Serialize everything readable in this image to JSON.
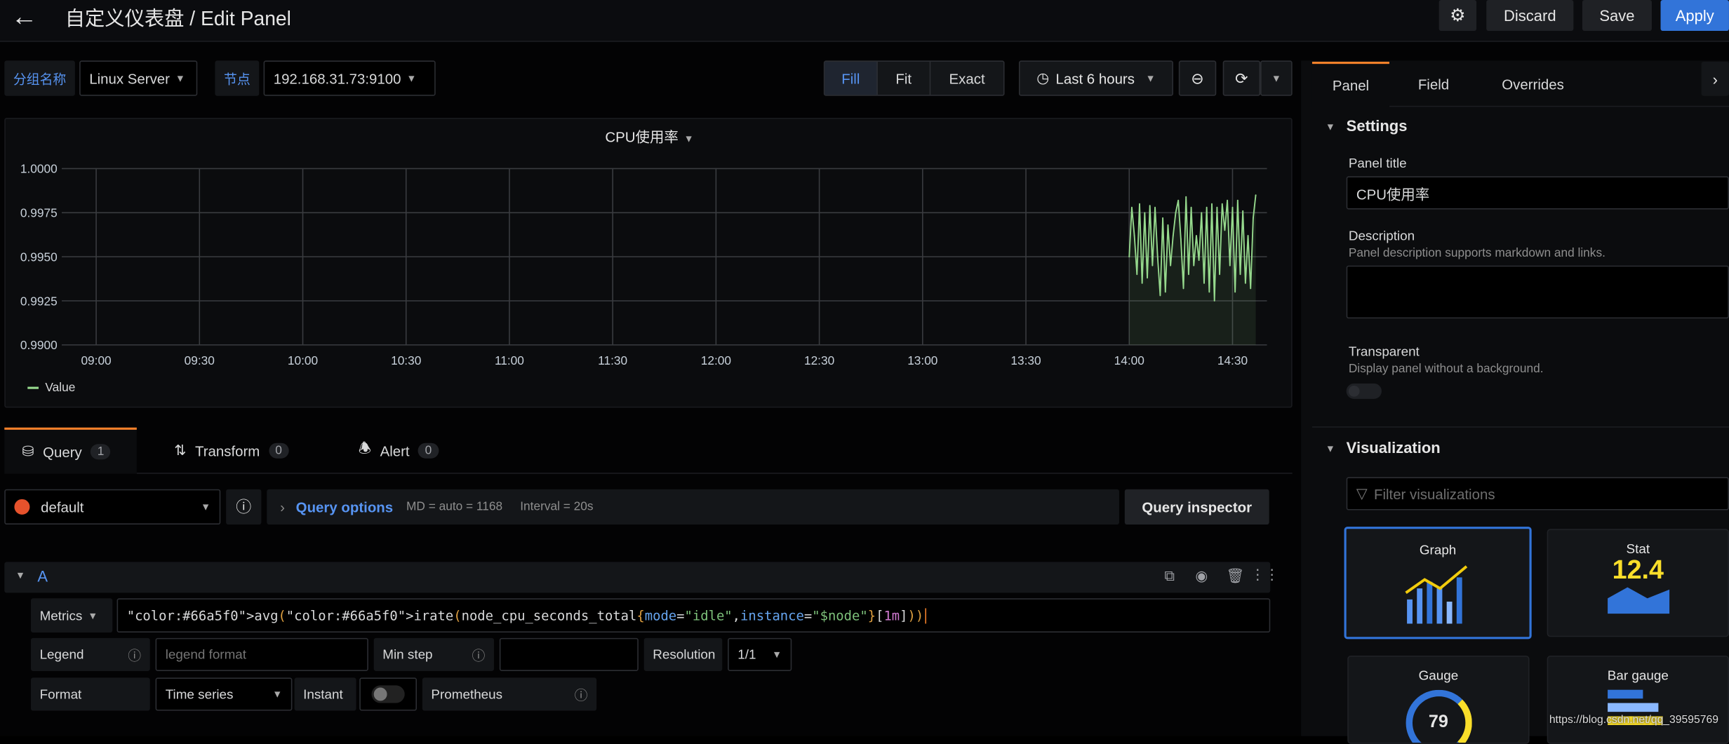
{
  "header": {
    "title": "自定义仪表盘 / Edit Panel",
    "discard": "Discard",
    "save": "Save",
    "apply": "Apply",
    "accent": "#3274d9"
  },
  "variables": [
    {
      "label": "分组名称",
      "value": "Linux Server"
    },
    {
      "label": "节点",
      "value": "192.168.31.73:9100"
    }
  ],
  "view_modes": {
    "options": [
      "Fill",
      "Fit",
      "Exact"
    ],
    "selected": "Fill"
  },
  "time_picker": {
    "value": "Last 6 hours"
  },
  "chart_data": {
    "type": "line",
    "title": "CPU使用率",
    "ylim": [
      0.99,
      1.0
    ],
    "yticks": [
      "1.0000",
      "0.9975",
      "0.9950",
      "0.9925",
      "0.9900"
    ],
    "xticks": [
      "09:00",
      "09:30",
      "10:00",
      "10:30",
      "11:00",
      "11:30",
      "12:00",
      "12:30",
      "13:00",
      "13:30",
      "14:00",
      "14:30"
    ],
    "xlim": [
      "08:50",
      "14:40"
    ],
    "grid": true,
    "legend_position": "bottom-left",
    "series": [
      {
        "name": "Value",
        "color": "#96d98d",
        "x": [
          "14:00",
          "14:00:45",
          "14:01:30",
          "14:02:15",
          "14:03",
          "14:03:45",
          "14:04:30",
          "14:05:15",
          "14:06",
          "14:06:45",
          "14:07:30",
          "14:08:15",
          "14:09",
          "14:09:45",
          "14:10:30",
          "14:11:15",
          "14:12",
          "14:12:45",
          "14:13:30",
          "14:14:15",
          "14:15",
          "14:15:45",
          "14:16:30",
          "14:17:15",
          "14:18",
          "14:18:45",
          "14:19:30",
          "14:20:15",
          "14:21",
          "14:21:45",
          "14:22:30",
          "14:23:15",
          "14:24",
          "14:24:45",
          "14:25:30",
          "14:26:15",
          "14:27",
          "14:27:45",
          "14:28:30",
          "14:29:15",
          "14:30",
          "14:30:45",
          "14:31:30",
          "14:32:15",
          "14:33",
          "14:33:45",
          "14:34:30",
          "14:35:15",
          "14:36",
          "14:36:45"
        ],
        "values": [
          0.995,
          0.9978,
          0.9962,
          0.994,
          0.998,
          0.9935,
          0.9975,
          0.9938,
          0.9979,
          0.9945,
          0.9978,
          0.995,
          0.9928,
          0.9972,
          0.993,
          0.9968,
          0.9945,
          0.9962,
          0.9975,
          0.9982,
          0.996,
          0.9932,
          0.9984,
          0.994,
          0.9978,
          0.9945,
          0.9962,
          0.9948,
          0.9975,
          0.9935,
          0.9978,
          0.993,
          0.998,
          0.9925,
          0.9978,
          0.994,
          0.998,
          0.9965,
          0.9982,
          0.9945,
          0.9978,
          0.993,
          0.9982,
          0.994,
          0.9976,
          0.9935,
          0.9962,
          0.9932,
          0.9972,
          0.9985
        ]
      }
    ]
  },
  "query_tabs": [
    {
      "label": "Query",
      "count": "1"
    },
    {
      "label": "Transform",
      "count": "0"
    },
    {
      "label": "Alert",
      "count": "0"
    }
  ],
  "datasource": {
    "value": "default",
    "query_options": "Query options",
    "md": "MD = auto = 1168",
    "interval": "Interval = 20s",
    "inspector": "Query inspector"
  },
  "query": {
    "ref": "A",
    "metrics_label": "Metrics",
    "expr": "avg(irate(node_cpu_seconds_total{mode=\"idle\",instance=\"$node\"}[1m]))",
    "legend_label": "Legend",
    "legend_placeholder": "legend format",
    "min_step_label": "Min step",
    "resolution_label": "Resolution",
    "resolution_value": "1/1",
    "format_label": "Format",
    "format_value": "Time series",
    "instant_label": "Instant",
    "instant_on": false,
    "prometheus_label": "Prometheus"
  },
  "options_pane": {
    "tabs": [
      "Panel",
      "Field",
      "Overrides"
    ],
    "active_tab": "Panel",
    "settings": {
      "heading": "Settings",
      "panel_title_label": "Panel title",
      "panel_title_value": "CPU使用率",
      "description_label": "Description",
      "description_help": "Panel description supports markdown and links.",
      "description_value": "",
      "transparent_label": "Transparent",
      "transparent_help": "Display panel without a background.",
      "transparent_on": false
    },
    "visualization": {
      "heading": "Visualization",
      "filter_placeholder": "Filter visualizations",
      "cards": [
        {
          "label": "Graph",
          "selected": true
        },
        {
          "label": "Stat",
          "value": "12.4"
        },
        {
          "label": "Gauge",
          "value": "79"
        },
        {
          "label": "Bar gauge"
        }
      ]
    }
  },
  "watermark": "https://blog.csdn.net/qq_39595769"
}
